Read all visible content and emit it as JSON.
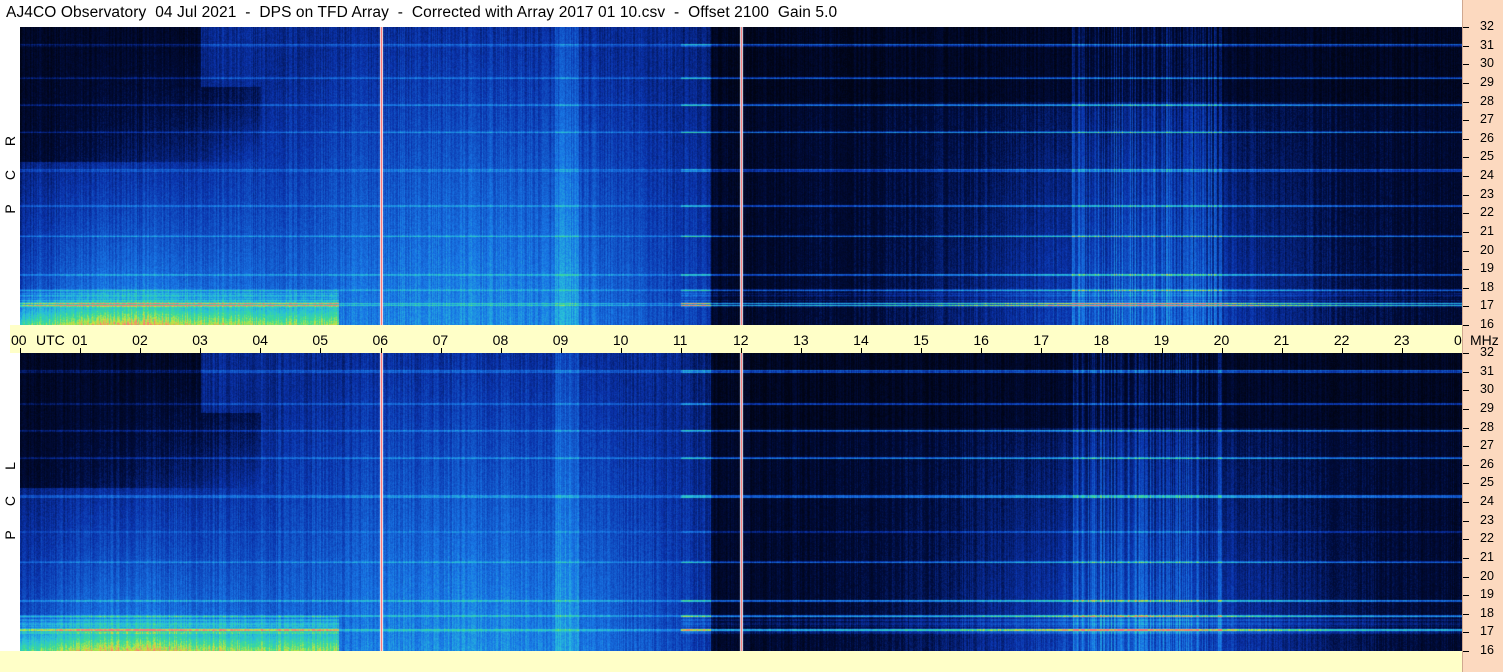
{
  "title": "AJ4CO Observatory  04 Jul 2021  -  DPS on TFD Array  -  Corrected with Array 2017 01 10.csv  -  Offset 2100  Gain 5.0",
  "panels": [
    {
      "id": "top",
      "polarization_letters": [
        "R",
        "C",
        "P"
      ]
    },
    {
      "id": "bottom",
      "polarization_letters": [
        "L",
        "C",
        "P"
      ]
    }
  ],
  "chart_data": {
    "type": "heatmap",
    "description_fields": {
      "x_axis": "UTC hour",
      "y_axis": "MHz"
    },
    "x_ticks": [
      "00",
      "01",
      "02",
      "03",
      "04",
      "05",
      "06",
      "07",
      "08",
      "09",
      "10",
      "11",
      "12",
      "13",
      "14",
      "15",
      "16",
      "17",
      "18",
      "19",
      "20",
      "21",
      "22",
      "23",
      "00"
    ],
    "x_unit_label": "UTC",
    "y_unit_label": "MHz",
    "y_ticks": [
      "16",
      "17",
      "18",
      "19",
      "20",
      "21",
      "22",
      "23",
      "24",
      "25",
      "26",
      "27",
      "28",
      "29",
      "30",
      "31",
      "32"
    ],
    "xlim": [
      0,
      24
    ],
    "ylim": [
      16,
      32
    ],
    "marker_hours": [
      6,
      12
    ],
    "colors": {
      "background": "#000814",
      "low": "#0a2a80",
      "mid": "#1a78e0",
      "high": "#30d0a0",
      "peak": "#f0e040",
      "marker_6": "#ff5050",
      "marker_12": "#d0f0ff"
    }
  }
}
